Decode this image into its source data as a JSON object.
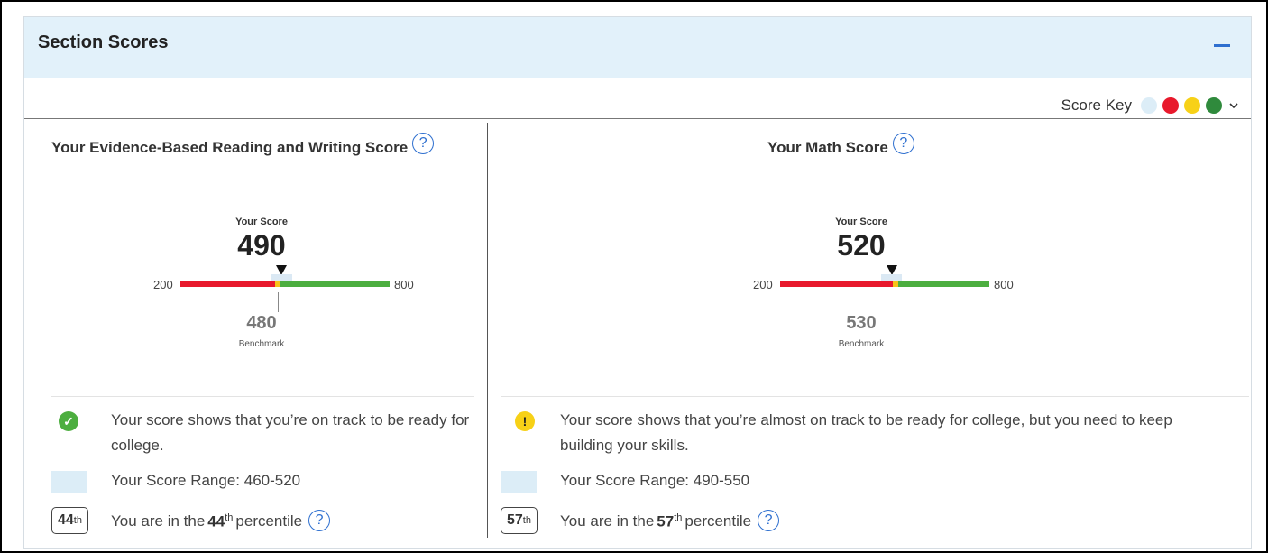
{
  "panel": {
    "title": "Section Scores",
    "collapse_icon": "minus-icon"
  },
  "score_key": {
    "label": "Score Key",
    "dots": [
      "#dcedf7",
      "#e8192c",
      "#f7d117",
      "#2f8a3c"
    ],
    "chevron_icon": "chevron-down-icon"
  },
  "colors": {
    "red": "#e8192c",
    "yellow": "#f7c31a",
    "green": "#4cae3f",
    "accent": "#2e6fcf"
  },
  "sections": [
    {
      "title": "Your Evidence-Based Reading and Writing Score",
      "help": "?",
      "your_score_label": "Your Score",
      "score": 490,
      "scale_min": 200,
      "scale_max": 800,
      "range": [
        460,
        520
      ],
      "benchmark": 480,
      "benchmark_label": "Benchmark",
      "status": "on-track",
      "status_icon": "check-icon",
      "status_text": "Your score shows that you’re on track to be ready for college.",
      "range_text": "Your Score Range: 460-520",
      "percentile": "44",
      "percentile_sup": "th",
      "pct_prefix": "You are in the",
      "pct_suffix": "percentile"
    },
    {
      "title": "Your Math Score",
      "help": "?",
      "your_score_label": "Your Score",
      "score": 520,
      "scale_min": 200,
      "scale_max": 800,
      "range": [
        490,
        550
      ],
      "benchmark": 530,
      "benchmark_label": "Benchmark",
      "status": "almost-on-track",
      "status_icon": "exclamation-icon",
      "status_text": "Your score shows that you’re almost on track to be ready for college, but you need to keep building your skills.",
      "range_text": "Your Score Range: 490-550",
      "percentile": "57",
      "percentile_sup": "th",
      "pct_prefix": "You are in the",
      "pct_suffix": "percentile"
    }
  ]
}
